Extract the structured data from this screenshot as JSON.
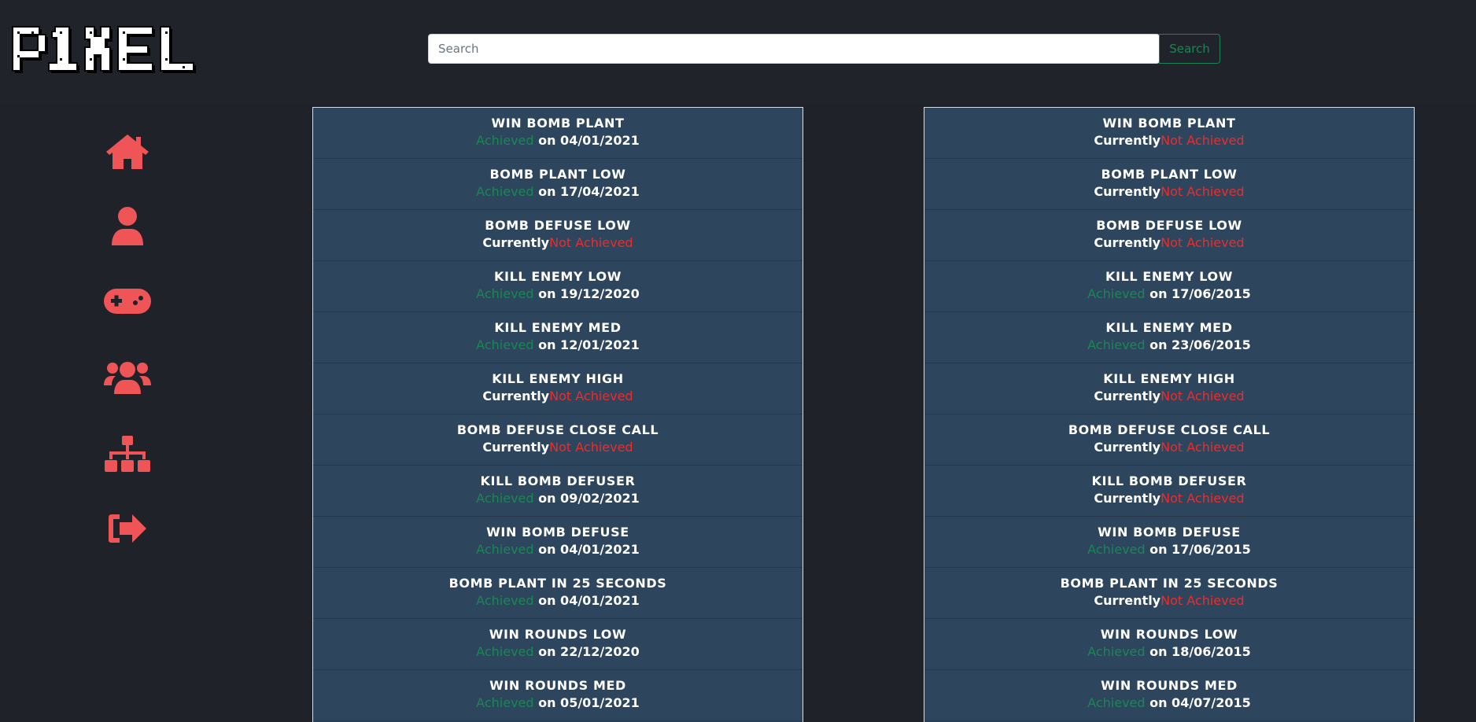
{
  "header": {
    "logo_text": "P1XEL",
    "search": {
      "placeholder": "Search",
      "value": "",
      "button_label": "Search"
    }
  },
  "sidebar": {
    "items": [
      {
        "icon": "home-icon"
      },
      {
        "icon": "user-icon"
      },
      {
        "icon": "gamepad-icon"
      },
      {
        "icon": "users-icon"
      },
      {
        "icon": "sitemap-icon"
      },
      {
        "icon": "logout-icon"
      }
    ]
  },
  "colors": {
    "accent": "#ef5556",
    "achieved": "#198754",
    "not_achieved": "#ee2b2b",
    "panel_bg": "#2d465d",
    "page_bg": "#1f2229"
  },
  "left_panel": {
    "achievements": [
      {
        "title": "WIN BOMB PLANT",
        "parts": [
          {
            "text": "Achieved",
            "tone": "green"
          },
          {
            "text": " on 04/01/2021",
            "tone": "white"
          }
        ]
      },
      {
        "title": "BOMB PLANT LOW",
        "parts": [
          {
            "text": "Achieved",
            "tone": "green"
          },
          {
            "text": " on 17/04/2021",
            "tone": "white"
          }
        ]
      },
      {
        "title": "BOMB DEFUSE LOW",
        "parts": [
          {
            "text": "Currently",
            "tone": "white"
          },
          {
            "text": "Not Achieved",
            "tone": "red"
          }
        ]
      },
      {
        "title": "KILL ENEMY LOW",
        "parts": [
          {
            "text": "Achieved",
            "tone": "green"
          },
          {
            "text": " on 19/12/2020",
            "tone": "white"
          }
        ]
      },
      {
        "title": "KILL ENEMY MED",
        "parts": [
          {
            "text": "Achieved",
            "tone": "green"
          },
          {
            "text": " on 12/01/2021",
            "tone": "white"
          }
        ]
      },
      {
        "title": "KILL ENEMY HIGH",
        "parts": [
          {
            "text": "Currently",
            "tone": "white"
          },
          {
            "text": "Not Achieved",
            "tone": "red"
          }
        ]
      },
      {
        "title": "BOMB DEFUSE CLOSE CALL",
        "parts": [
          {
            "text": "Currently",
            "tone": "white"
          },
          {
            "text": "Not Achieved",
            "tone": "red"
          }
        ]
      },
      {
        "title": "KILL BOMB DEFUSER",
        "parts": [
          {
            "text": "Achieved",
            "tone": "green"
          },
          {
            "text": " on 09/02/2021",
            "tone": "white"
          }
        ]
      },
      {
        "title": "WIN BOMB DEFUSE",
        "parts": [
          {
            "text": "Achieved",
            "tone": "green"
          },
          {
            "text": " on 04/01/2021",
            "tone": "white"
          }
        ]
      },
      {
        "title": "BOMB PLANT IN 25 SECONDS",
        "parts": [
          {
            "text": "Achieved",
            "tone": "green"
          },
          {
            "text": " on 04/01/2021",
            "tone": "white"
          }
        ]
      },
      {
        "title": "WIN ROUNDS LOW",
        "parts": [
          {
            "text": "Achieved",
            "tone": "green"
          },
          {
            "text": " on 22/12/2020",
            "tone": "white"
          }
        ]
      },
      {
        "title": "WIN ROUNDS MED",
        "parts": [
          {
            "text": "Achieved",
            "tone": "green"
          },
          {
            "text": " on 05/01/2021",
            "tone": "white"
          }
        ]
      }
    ]
  },
  "right_panel": {
    "achievements": [
      {
        "title": "WIN BOMB PLANT",
        "parts": [
          {
            "text": "Currently",
            "tone": "white"
          },
          {
            "text": "Not Achieved",
            "tone": "red"
          }
        ]
      },
      {
        "title": "BOMB PLANT LOW",
        "parts": [
          {
            "text": "Currently",
            "tone": "white"
          },
          {
            "text": "Not Achieved",
            "tone": "red"
          }
        ]
      },
      {
        "title": "BOMB DEFUSE LOW",
        "parts": [
          {
            "text": "Currently",
            "tone": "white"
          },
          {
            "text": "Not Achieved",
            "tone": "red"
          }
        ]
      },
      {
        "title": "KILL ENEMY LOW",
        "parts": [
          {
            "text": "Achieved",
            "tone": "green"
          },
          {
            "text": " on 17/06/2015",
            "tone": "white"
          }
        ]
      },
      {
        "title": "KILL ENEMY MED",
        "parts": [
          {
            "text": "Achieved",
            "tone": "green"
          },
          {
            "text": " on 23/06/2015",
            "tone": "white"
          }
        ]
      },
      {
        "title": "KILL ENEMY HIGH",
        "parts": [
          {
            "text": "Currently",
            "tone": "white"
          },
          {
            "text": "Not Achieved",
            "tone": "red"
          }
        ]
      },
      {
        "title": "BOMB DEFUSE CLOSE CALL",
        "parts": [
          {
            "text": "Currently",
            "tone": "white"
          },
          {
            "text": "Not Achieved",
            "tone": "red"
          }
        ]
      },
      {
        "title": "KILL BOMB DEFUSER",
        "parts": [
          {
            "text": "Currently",
            "tone": "white"
          },
          {
            "text": "Not Achieved",
            "tone": "red"
          }
        ]
      },
      {
        "title": "WIN BOMB DEFUSE",
        "parts": [
          {
            "text": "Achieved",
            "tone": "green"
          },
          {
            "text": " on 17/06/2015",
            "tone": "white"
          }
        ]
      },
      {
        "title": "BOMB PLANT IN 25 SECONDS",
        "parts": [
          {
            "text": "Currently",
            "tone": "white"
          },
          {
            "text": "Not Achieved",
            "tone": "red"
          }
        ]
      },
      {
        "title": "WIN ROUNDS LOW",
        "parts": [
          {
            "text": "Achieved",
            "tone": "green"
          },
          {
            "text": " on 18/06/2015",
            "tone": "white"
          }
        ]
      },
      {
        "title": "WIN ROUNDS MED",
        "parts": [
          {
            "text": "Achieved",
            "tone": "green"
          },
          {
            "text": " on 04/07/2015",
            "tone": "white"
          }
        ]
      }
    ]
  }
}
